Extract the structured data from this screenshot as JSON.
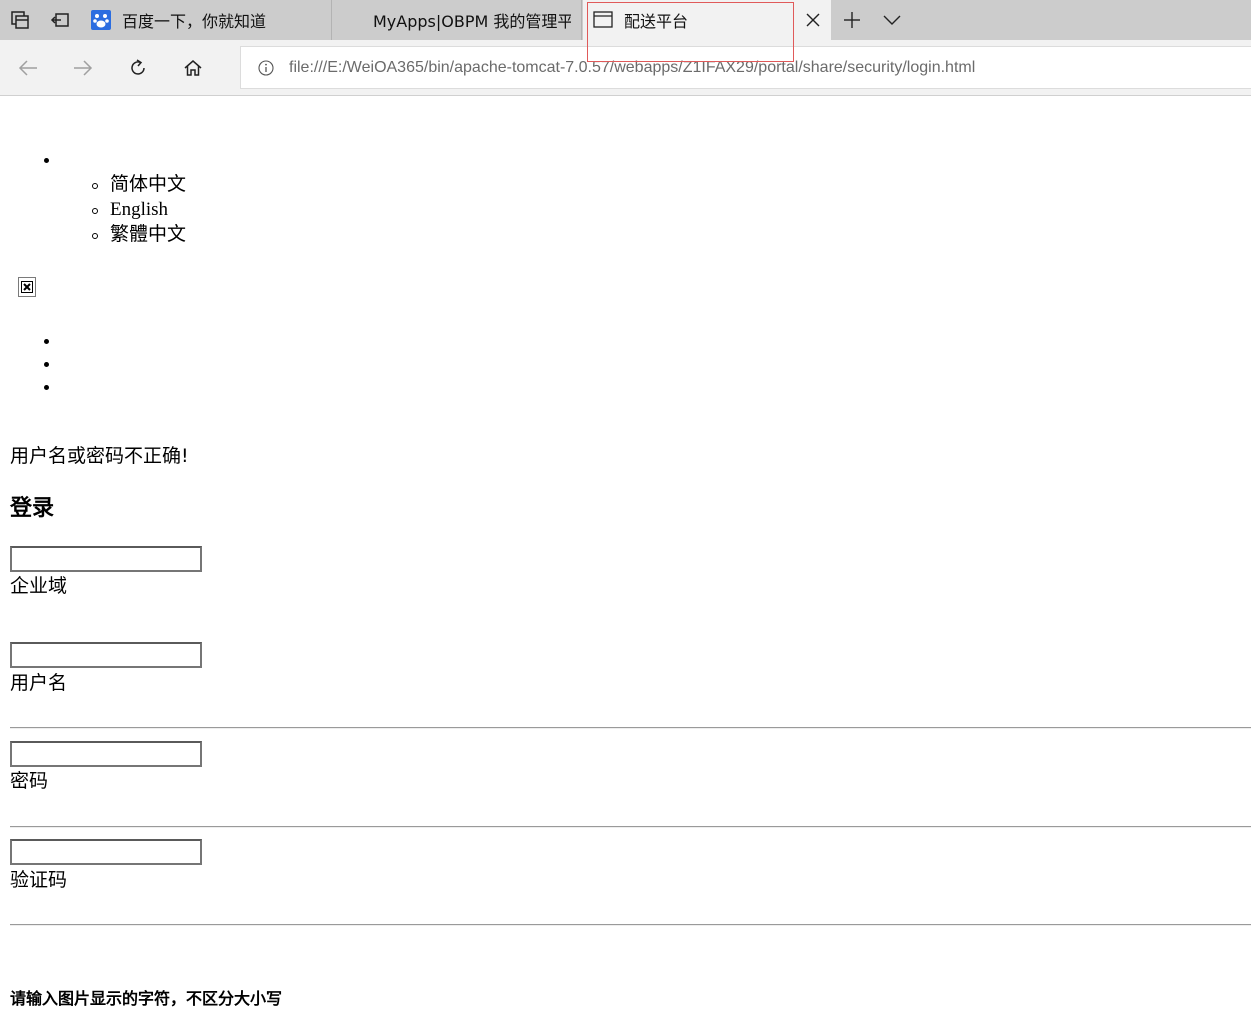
{
  "browser": {
    "tabs": [
      {
        "title": "百度一下，你就知道",
        "favicon": "baidu-paw-icon",
        "active": false
      },
      {
        "title": "MyApps|OBPM 我的管理平台",
        "favicon": "",
        "active": false
      },
      {
        "title": "配送平台",
        "favicon": "page-icon",
        "active": true
      }
    ],
    "address": {
      "url": "file:///E:/WeiOA365/bin/apache-tomcat-7.0.57/webapps/Z1IFAX29/portal/share/security/login.html"
    }
  },
  "page": {
    "languages": [
      "简体中文",
      "English",
      "繁體中文"
    ],
    "error_message": "用户名或密码不正确!",
    "login_title": "登录",
    "fields": {
      "domain_label": "企业域",
      "username_label": "用户名",
      "password_label": "密码",
      "captcha_label": "验证码"
    },
    "captcha_hint": "请输入图片显示的字符，不区分大小写"
  },
  "colors": {
    "tabstrip_bg": "#cccccc",
    "active_tab_bg": "#f2f2f2",
    "highlight_border": "#e05a5a",
    "url_text": "#6b6b6b"
  }
}
